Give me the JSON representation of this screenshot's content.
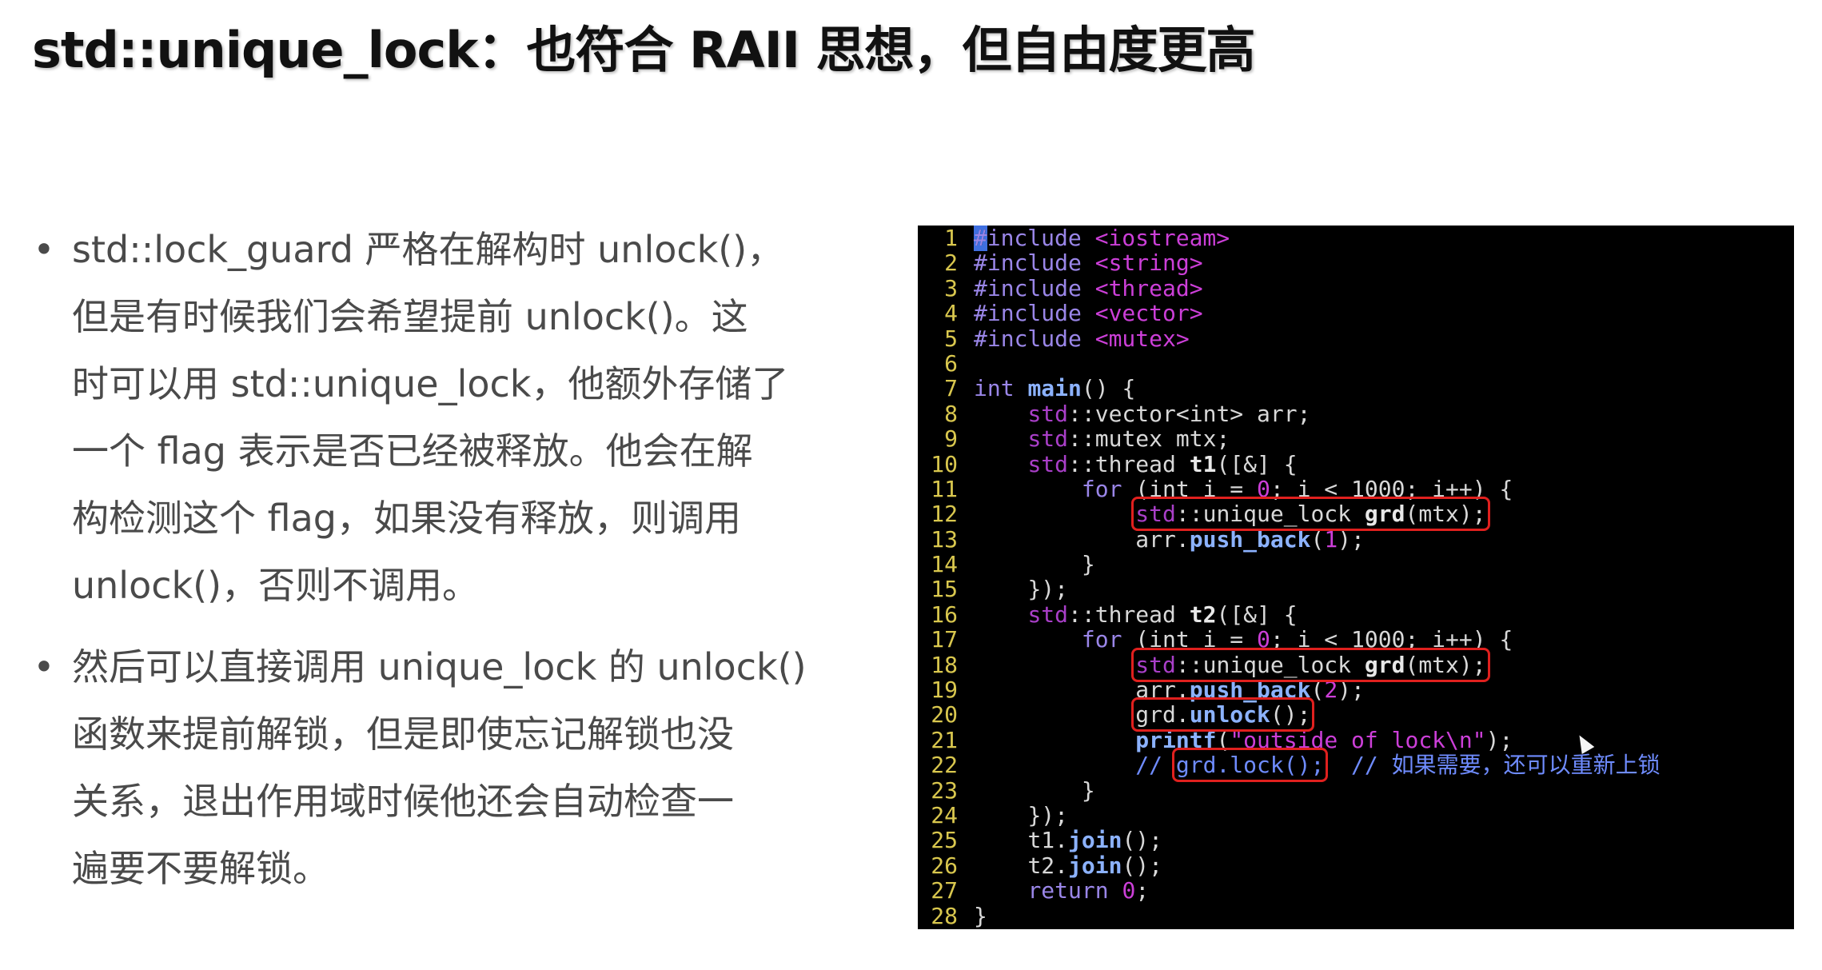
{
  "slide": {
    "title": "std::unique_lock：也符合 RAII 思想，但自由度更高"
  },
  "bullets": [
    {
      "dot": "•",
      "text": "std::lock_guard 严格在解构时 unlock()，\n但是有时候我们会希望提前 unlock()。这\n时可以用 std::unique_lock，他额外存储了\n一个 flag 表示是否已经被释放。他会在解\n构检测这个 flag，如果没有释放，则调用\nunlock()，否则不调用。"
    },
    {
      "dot": "•",
      "text": "然后可以直接调用 unique_lock 的 unlock()\n函数来提前解锁，但是即使忘记解锁也没\n关系，退出作用域时候他还会自动检查一\n遍要不要解锁。"
    }
  ],
  "code": {
    "line_numbers": [
      "1",
      "2",
      "3",
      "4",
      "5",
      "6",
      "7",
      "8",
      "9",
      "10",
      "11",
      "12",
      "13",
      "14",
      "15",
      "16",
      "17",
      "18",
      "19",
      "20",
      "21",
      "22",
      "23",
      "24",
      "25",
      "26",
      "27",
      "28"
    ],
    "colors": {
      "background": "#000000",
      "line_number": "#d9c74e",
      "preprocessor": "#9a86e8",
      "string": "#cc3fd8",
      "highlight_box": "#e0201e"
    },
    "lines": [
      {
        "pp": "#include",
        "str": " <iostream>"
      },
      {
        "pp": "#include",
        "str": " <string>"
      },
      {
        "pp": "#include",
        "str": " <thread>"
      },
      {
        "pp": "#include",
        "str": " <vector>"
      },
      {
        "pp": "#include",
        "str": " <mutex>"
      },
      {},
      {
        "kw": "int",
        "fn": "main",
        "rest": "() {"
      },
      {
        "indent": "    ",
        "ns": "std",
        "sep": "::",
        "type": "vector<int>",
        "rest": " arr;"
      },
      {
        "indent": "    ",
        "ns": "std",
        "sep": "::",
        "type": "mutex",
        "rest": " mtx;"
      },
      {
        "indent": "    ",
        "ns": "std",
        "sep": "::",
        "type": "thread",
        "id": "t1",
        "rest": "([&] {"
      },
      {
        "indent": "        ",
        "kw": "for",
        "rest1": " (int i = ",
        "num": "0",
        "rest2": "; i < 1000; i++) {"
      },
      {
        "indent": "            ",
        "ns": "std",
        "sep": "::",
        "type": "unique_lock",
        "id": "grd",
        "rest": "(mtx);"
      },
      {
        "indent": "            ",
        "obj": "arr.",
        "fn": "push_back",
        "rest1": "(",
        "num": "1",
        "rest2": ");"
      },
      {
        "indent": "        ",
        "rest": "}"
      },
      {
        "indent": "    ",
        "rest": "});"
      },
      {
        "indent": "    ",
        "ns": "std",
        "sep": "::",
        "type": "thread",
        "id": "t2",
        "rest": "([&] {"
      },
      {
        "indent": "        ",
        "kw": "for",
        "rest1": " (int i = ",
        "num": "0",
        "rest2": "; i < 1000; i++) {"
      },
      {
        "indent": "            ",
        "ns": "std",
        "sep": "::",
        "type": "unique_lock",
        "id": "grd",
        "rest": "(mtx);"
      },
      {
        "indent": "            ",
        "obj": "arr.",
        "fn": "push_back",
        "rest1": "(",
        "num": "2",
        "rest2": ");"
      },
      {
        "indent": "            ",
        "obj": "grd.",
        "fn": "unlock",
        "rest": "();"
      },
      {
        "indent": "            ",
        "fn": "printf",
        "rest1": "(",
        "str": "\"outside of lock\\n\"",
        "rest2": ");"
      },
      {
        "indent": "            ",
        "cm1": "// ",
        "cm2": "grd.lock();",
        "cm3": "  // 如果需要，还可以重新上锁"
      },
      {
        "indent": "        ",
        "rest": "}"
      },
      {
        "indent": "    ",
        "rest": "});"
      },
      {
        "indent": "    ",
        "obj": "t1.",
        "fn": "join",
        "rest": "();"
      },
      {
        "indent": "    ",
        "obj": "t2.",
        "fn": "join",
        "rest": "();"
      },
      {
        "indent": "    ",
        "kw": "return",
        "rest1": " ",
        "num": "0",
        "rest2": ";"
      },
      {
        "rest": "}"
      }
    ]
  }
}
